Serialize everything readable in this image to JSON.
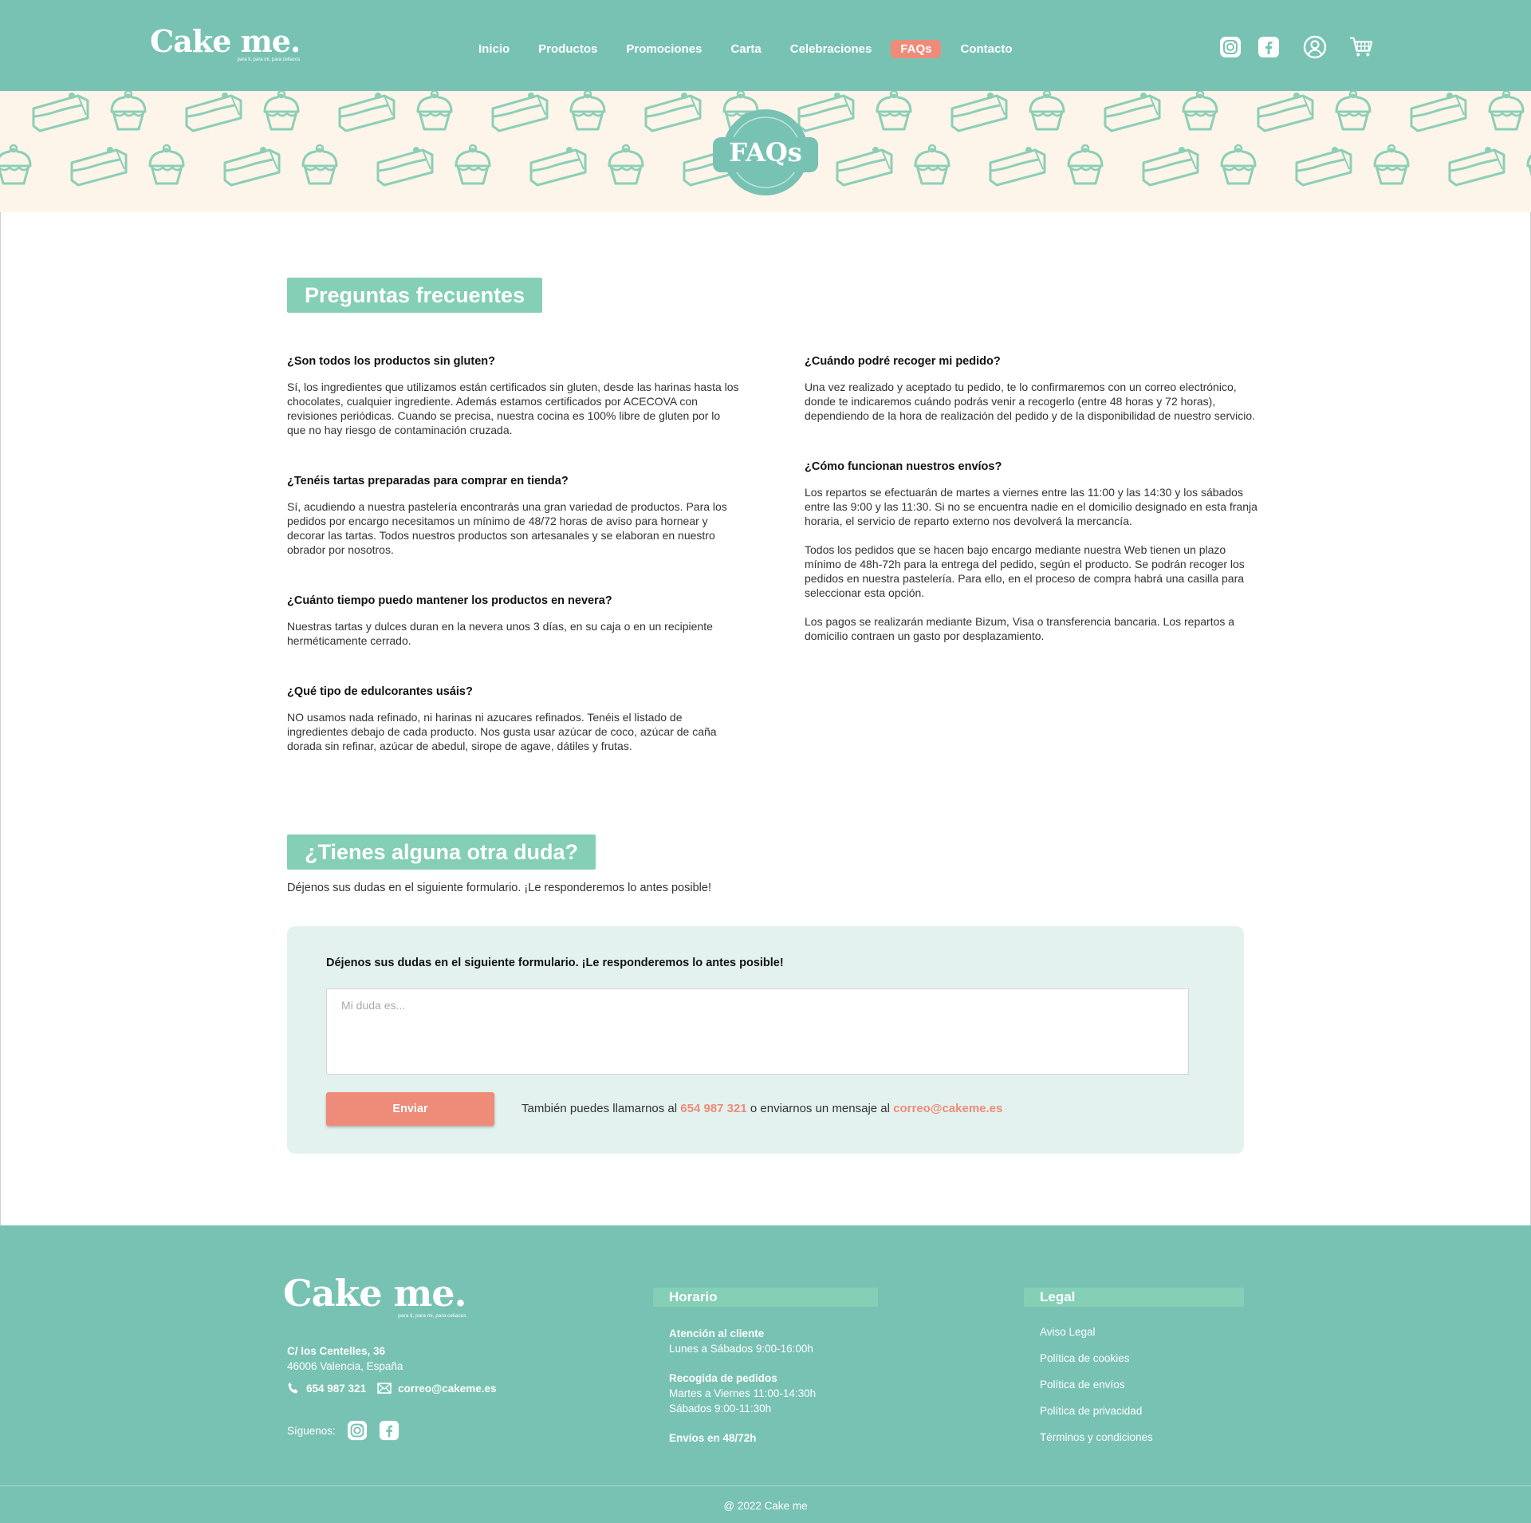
{
  "brand": {
    "name": "Cake me.",
    "tagline": "para ti, para mi, para celiacos"
  },
  "nav": {
    "items": [
      {
        "label": "Inicio"
      },
      {
        "label": "Productos"
      },
      {
        "label": "Promociones"
      },
      {
        "label": "Carta"
      },
      {
        "label": "Celebraciones"
      },
      {
        "label": "FAQs",
        "active": true
      },
      {
        "label": "Contacto"
      }
    ],
    "icons": [
      "instagram-icon",
      "facebook-icon",
      "user-icon",
      "cart-icon"
    ]
  },
  "banner": {
    "badge": "FAQs"
  },
  "faq": {
    "title": "Preguntas frecuentes",
    "left": [
      {
        "q": "¿Son todos los productos sin gluten?",
        "a": [
          "Sí, los ingredientes que utilizamos están certificados sin gluten, desde las harinas hasta los chocolates, cualquier ingrediente. Además estamos certificados por ACECOVA con revisiones periódicas. Cuando se precisa, nuestra cocina es 100% libre de gluten por lo que no hay riesgo de contaminación cruzada."
        ]
      },
      {
        "q": "¿Tenéis tartas preparadas para comprar en tienda?",
        "a": [
          "Sí, acudiendo a nuestra pastelería encontrarás una gran variedad de productos. Para los pedidos por encargo necesitamos un mínimo de 48/72 horas de aviso para hornear y decorar las tartas. Todos nuestros productos son artesanales y se elaboran en nuestro obrador por nosotros."
        ]
      },
      {
        "q": "¿Cuánto tiempo puedo mantener los productos en nevera?",
        "a": [
          "Nuestras tartas y dulces duran en la nevera unos 3 días, en su caja o en un recipiente herméticamente cerrado."
        ]
      },
      {
        "q": "¿Qué tipo de edulcorantes usáis?",
        "a": [
          "NO usamos nada refinado, ni harinas ni azucares refinados. Tenéis el listado de ingredientes debajo de cada producto. Nos gusta usar azúcar de coco, azúcar de caña dorada sin refinar, azúcar de abedul, sirope de agave, dátiles y frutas."
        ]
      }
    ],
    "right": [
      {
        "q": "¿Cuándo podré recoger mi pedido?",
        "a": [
          "Una vez realizado y aceptado tu pedido, te lo confirmaremos con un correo electrónico, donde te indicaremos cuándo podrás venir a recogerlo (entre 48 horas y 72 horas), dependiendo de la hora de realización del pedido y de la disponibilidad de nuestro servicio."
        ]
      },
      {
        "q": "¿Cómo funcionan nuestros envíos?",
        "a": [
          "Los repartos se efectuarán de martes a viernes entre las 11:00 y las 14:30 y los sábados entre las 9:00 y las 11:30. Si no se encuentra nadie en el domicilio designado en esta franja horaria, el servicio de reparto externo nos devolverá la mercancía.",
          "Todos los pedidos que se hacen bajo encargo mediante nuestra Web tienen un plazo mínimo de 48h-72h para la entrega del pedido, según el producto. Se podrán recoger los pedidos en nuestra pastelería. Para ello, en el proceso de compra habrá una casilla para seleccionar esta opción.",
          "Los pagos se realizarán mediante Bizum, Visa o transferencia bancaria. Los repartos a domicilio contraen un gasto por desplazamiento."
        ]
      }
    ]
  },
  "contact_section": {
    "title": "¿Tienes alguna otra duda?",
    "intro": "Déjenos sus dudas en el siguiente formulario. ¡Le responderemos lo antes posible!",
    "form_label": "Déjenos sus dudas en el siguiente formulario. ¡Le responderemos lo antes posible!",
    "placeholder": "Mi duda es...",
    "value": "",
    "send_label": "Enviar",
    "note_prefix": "También puedes llamarnos al ",
    "phone": "654 987 321",
    "note_mid": " o enviarnos un mensaje al ",
    "email": "correo@cakeme.es"
  },
  "footer": {
    "address_line1": "C/ los Centelles, 36",
    "address_line2": "46006 Valencia, España",
    "phone": "654 987 321",
    "email": "correo@cakeme.es",
    "follow_label": "Síguenos:",
    "hours_title": "Horario",
    "hours": [
      {
        "title": "Atención al cliente",
        "lines": [
          "Lunes a Sábados 9:00-16:00h"
        ]
      },
      {
        "title": "Recogida de pedidos",
        "lines": [
          "Martes a Viernes 11:00-14:30h",
          "Sábados 9:00-11:30h"
        ]
      },
      {
        "title": "Envíos en 48/72h",
        "lines": []
      }
    ],
    "legal_title": "Legal",
    "legal_links": [
      "Aviso Legal",
      "Política de cookies",
      "Política de envíos",
      "Política de privacidad",
      "Términos y condiciones"
    ],
    "copyright": "@ 2022 Cake me"
  },
  "colors": {
    "teal": "#78c2b3",
    "mint": "#84cfb6",
    "coral": "#ef8b79",
    "cream": "#fdf4ea",
    "form_bg": "#e3f2ee"
  }
}
